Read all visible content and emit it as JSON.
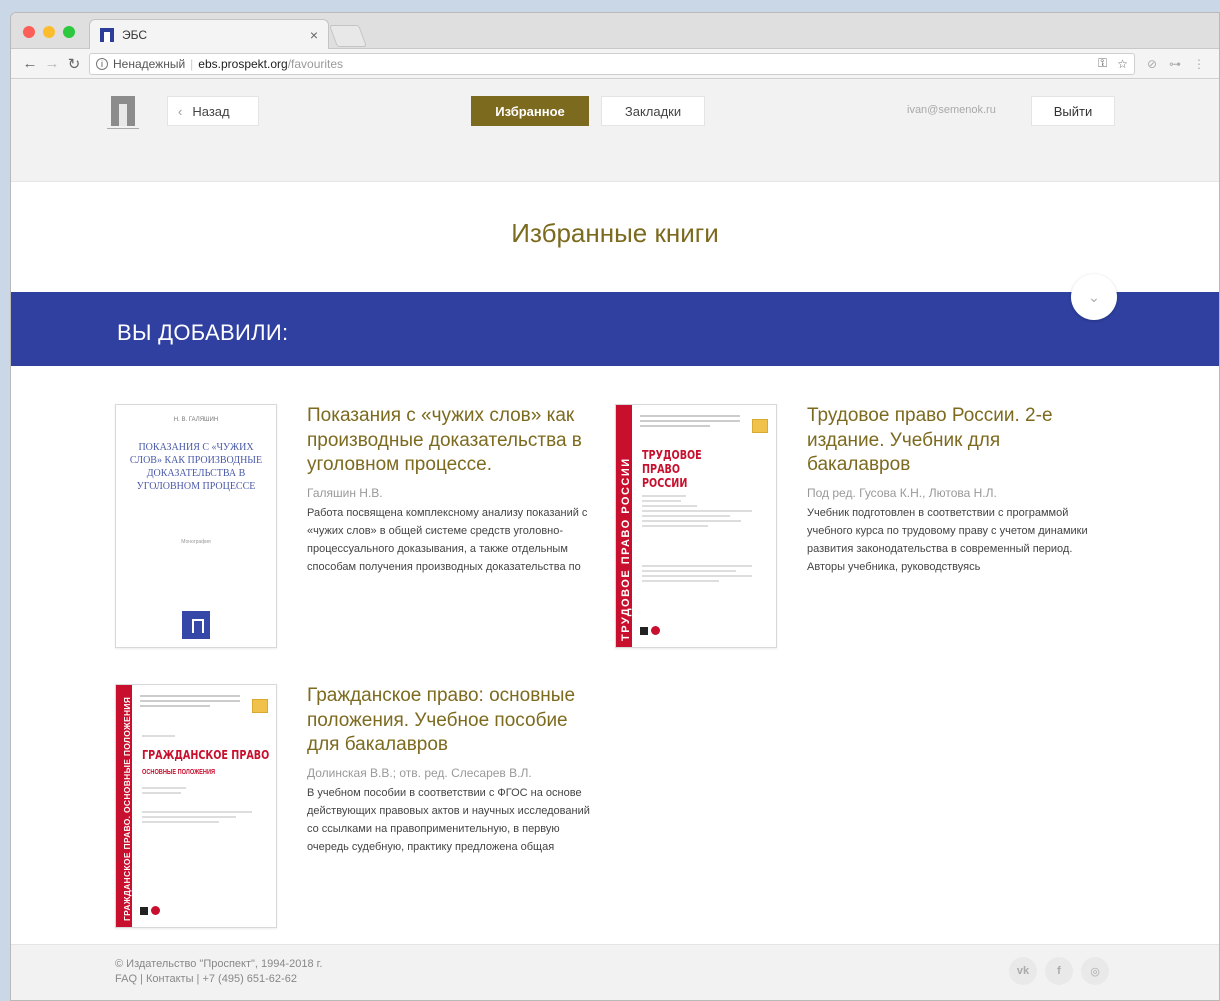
{
  "browser": {
    "tab_title": "ЭБС",
    "tab_close": "×",
    "url_insecure": "Ненадежный",
    "url_host": "ebs.prospekt.org",
    "url_path": "/favourites"
  },
  "nav": {
    "back_label": "Назад",
    "favourites_label": "Избранное",
    "bookmarks_label": "Закладки",
    "user_email": "ivan@semenok.ru",
    "logout_label": "Выйти"
  },
  "page_title": "Избранные книги",
  "section_title": "ВЫ ДОБАВИЛИ:",
  "books": [
    {
      "title": "Показания с «чужих слов» как производные доказательства в уголовном процессе.",
      "authors": "Галяшин Н.В.",
      "description": "Работа посвящена комплексному анализу показаний с «чужих слов» в общей системе средств уголовно-процессуального доказывания, а также отдельным способам получения производных доказательства по",
      "cover_author": "Н. В. ГАЛЯШИН",
      "cover_title": "ПОКАЗАНИЯ С «ЧУЖИХ СЛОВ» КАК ПРОИЗВОДНЫЕ ДОКАЗАТЕЛЬСТВА В УГОЛОВНОМ ПРОЦЕССЕ",
      "cover_subtitle": "Монография"
    },
    {
      "title": "Трудовое право России. 2-е издание. Учебник для бакалавров",
      "authors": "Под ред. Гусова К.Н., Лютова Н.Л.",
      "description": "Учебник подготовлен в соответствии с программой учебного курса по трудовому праву с учетом динамики развития законодательства в современный период. Авторы учебника, руководствуясь",
      "cover_spine": "ТРУДОВОЕ ПРАВО РОССИИ",
      "cover_title": "ТРУДОВОЕ ПРАВО РОССИИ"
    },
    {
      "title": "Гражданское право: основные положения. Учебное пособие для бакалавров",
      "authors": "Долинская В.В.; отв. ред. Слесарев В.Л.",
      "description": "В учебном пособии в соответствии с ФГОС на основе действующих правовых актов и научных исследований со ссылками на правоприменительную, в первую очередь судебную, практику предложена общая",
      "cover_spine": "ГРАЖДАНСКОЕ ПРАВО. ОСНОВНЫЕ ПОЛОЖЕНИЯ",
      "cover_title": "ГРАЖДАНСКОЕ ПРАВО",
      "cover_subtitle": "ОСНОВНЫЕ ПОЛОЖЕНИЯ"
    }
  ],
  "footer": {
    "copyright": "© Издательство \"Проспект\", 1994-2018 г.",
    "links": "FAQ | Контакты | +7 (495) 651-62-62"
  },
  "social": {
    "vk": "vk",
    "fb": "f",
    "ig": "◎"
  },
  "colors": {
    "accent_gold": "#7c6a1f",
    "band_blue": "#2f40a0",
    "cover_red": "#c8102e"
  }
}
